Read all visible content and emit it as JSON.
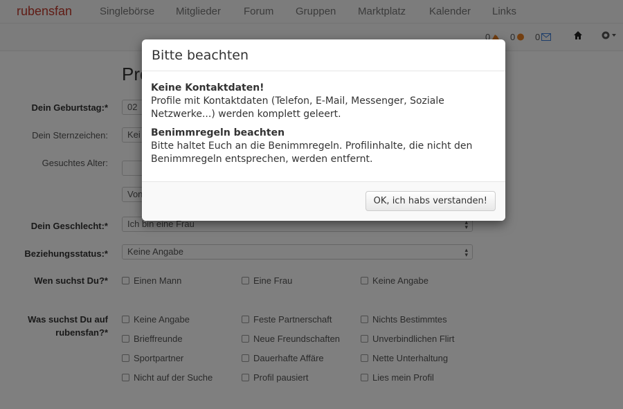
{
  "navbar": {
    "brand": "rubensfan",
    "items": [
      "Singlebörse",
      "Mitglieder",
      "Forum",
      "Gruppen",
      "Marktplatz",
      "Kalender",
      "Links"
    ]
  },
  "stats": [
    {
      "count": "0",
      "icon": "finger-icon"
    },
    {
      "count": "0",
      "icon": "smiley-icon"
    },
    {
      "count": "0",
      "icon": "envelope-icon"
    }
  ],
  "page": {
    "title": "Pro"
  },
  "form": {
    "birthday": {
      "label": "Dein Geburtstag:*",
      "value": "02"
    },
    "zodiac": {
      "label": "Dein Sternzeichen:",
      "value": "Kei"
    },
    "age": {
      "label": "Gesuchtes Alter:",
      "from": "Von"
    },
    "gender": {
      "label": "Dein Geschlecht:*",
      "value": "Ich bin eine Frau"
    },
    "relationship": {
      "label": "Beziehungsstatus:*",
      "value": "Keine Angabe"
    },
    "seeking": {
      "label": "Wen suchst Du?*",
      "options": [
        "Einen Mann",
        "Eine Frau",
        "Keine Angabe"
      ]
    },
    "looking_for": {
      "label_line1": "Was suchst Du auf",
      "label_line2": "rubensfan?*",
      "options": [
        "Keine Angabe",
        "Feste Partnerschaft",
        "Nichts Bestimmtes",
        "Brieffreunde",
        "Neue Freundschaften",
        "Unverbindlichen Flirt",
        "Sportpartner",
        "Dauerhafte Affäre",
        "Nette Unterhaltung",
        "Nicht auf der Suche",
        "Profil pausiert",
        "Lies mein Profil"
      ]
    }
  },
  "modal": {
    "title": "Bitte beachten",
    "sections": [
      {
        "heading": "Keine Kontaktdaten!",
        "text": "Profile mit Kontaktdaten (Telefon, E-Mail, Messenger, Soziale Netzwerke...) werden komplett geleert."
      },
      {
        "heading": "Benimmregeln beachten",
        "text": "Bitte haltet Euch an die Benimmregeln. Profilinhalte, die nicht den Benimmregeln entsprechen, werden entfernt."
      }
    ],
    "ok_label": "OK, ich habs verstanden!"
  },
  "colors": {
    "brand": "#c0392b",
    "backdrop": "rgba(0,0,0,0.5)"
  }
}
